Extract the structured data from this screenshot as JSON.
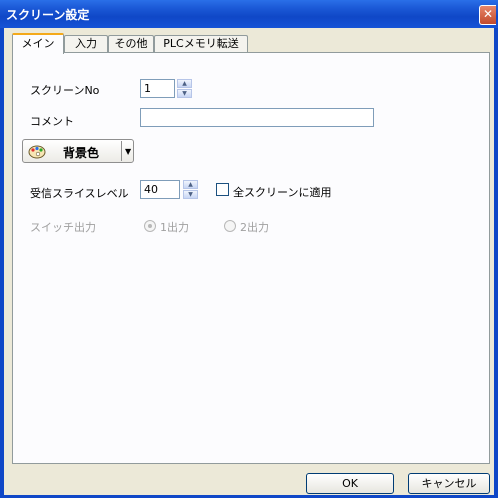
{
  "window": {
    "title": "スクリーン設定"
  },
  "tabs": [
    {
      "label": "メイン",
      "active": true
    },
    {
      "label": "入力",
      "active": false
    },
    {
      "label": "その他",
      "active": false
    },
    {
      "label": "PLCメモリ転送",
      "active": false
    }
  ],
  "main": {
    "screen_no_label": "スクリーンNo",
    "screen_no_value": "1",
    "comment_label": "コメント",
    "comment_value": "",
    "bg_color_button": "背景色",
    "slice_level_label": "受信スライスレベル",
    "slice_level_value": "40",
    "apply_all_label": "全スクリーンに適用",
    "apply_all_checked": false,
    "switch_output_label": "スイッチ出力",
    "switch_output_options": [
      {
        "label": "1出力",
        "selected": true
      },
      {
        "label": "2出力",
        "selected": false
      }
    ]
  },
  "footer": {
    "ok_label": "OK",
    "cancel_label": "キャンセル"
  }
}
